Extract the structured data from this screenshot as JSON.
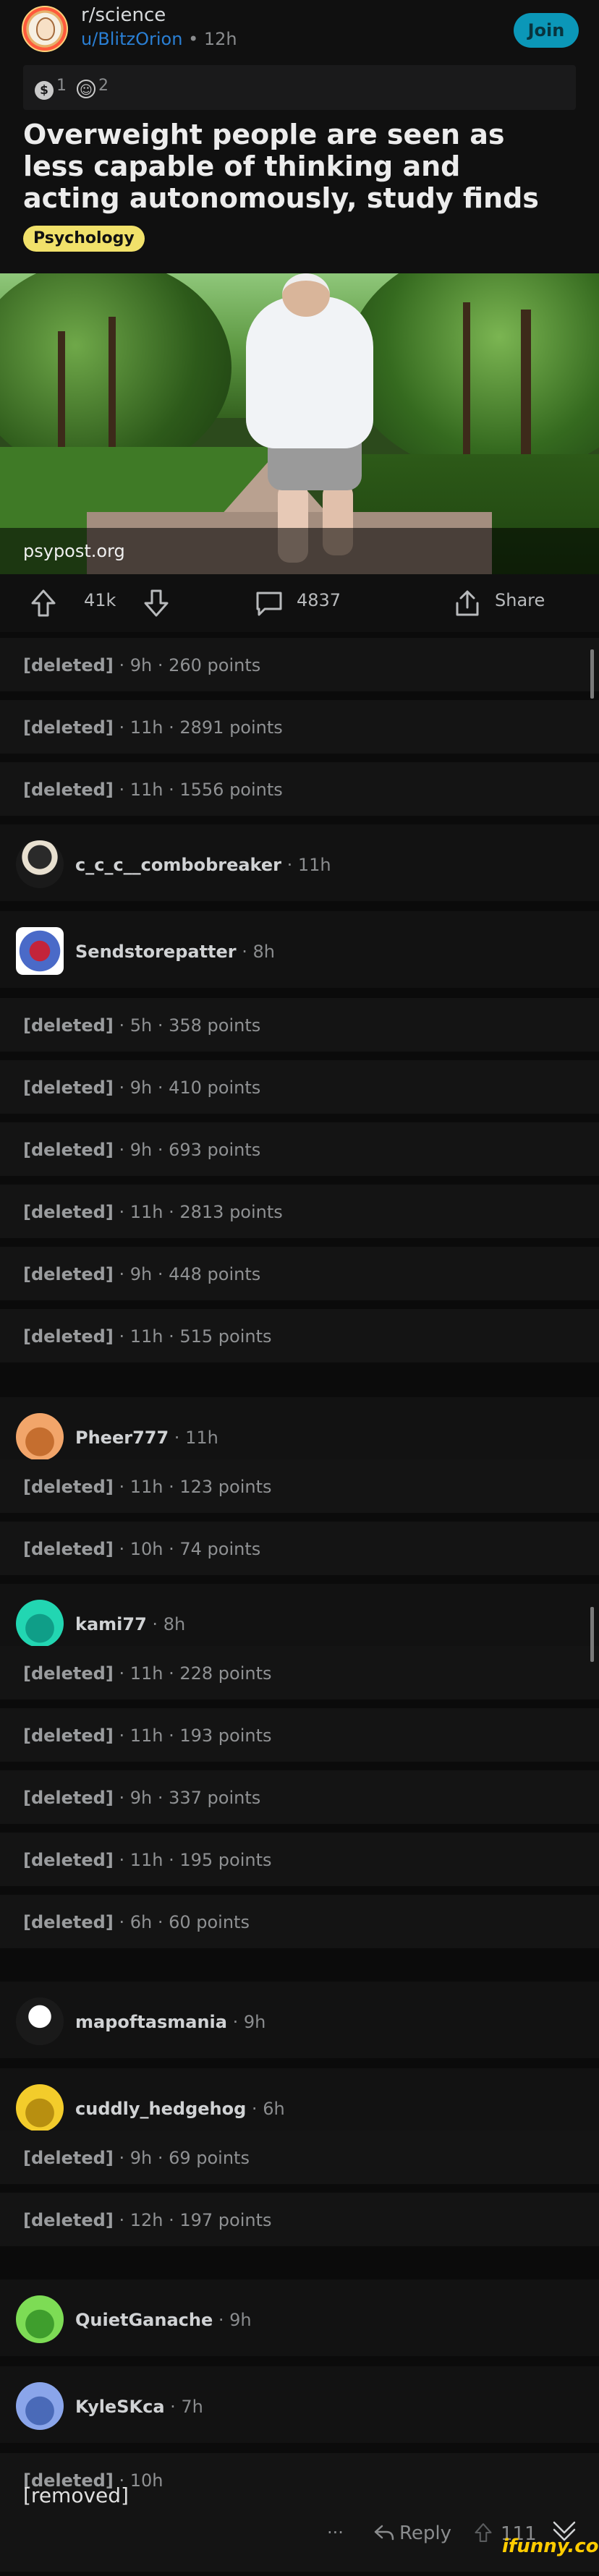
{
  "header": {
    "subreddit": "r/science",
    "username": "u/BlitzOrion",
    "separator": "•",
    "time": "12h",
    "join_label": "Join",
    "awards": [
      {
        "icon": "coin-award-icon",
        "count": "1"
      },
      {
        "icon": "helpful-award-icon",
        "count": "2"
      }
    ],
    "title": "Overweight people are seen as less capable of thinking and acting autonomously, study finds",
    "flair": "Psychology",
    "flair_color": "#f1e16a",
    "join_color": "#0b97b8"
  },
  "image": {
    "caption": "psypost.org"
  },
  "actions": {
    "upvotes": "41k",
    "comments": "4837",
    "share_label": "Share"
  },
  "comments": [
    {
      "type": "deleted",
      "author": "[deleted]",
      "time": "9h",
      "points": "260 points"
    },
    {
      "type": "deleted",
      "author": "[deleted]",
      "time": "11h",
      "points": "2891 points"
    },
    {
      "type": "deleted",
      "author": "[deleted]",
      "time": "11h",
      "points": "1556 points"
    },
    {
      "type": "user",
      "author": "c_c_c__combobreaker",
      "time": "11h"
    },
    {
      "type": "user",
      "author": "Sendstorepatter",
      "time": "8h"
    },
    {
      "type": "deleted",
      "author": "[deleted]",
      "time": "5h",
      "points": "358 points"
    },
    {
      "type": "deleted",
      "author": "[deleted]",
      "time": "9h",
      "points": "410 points"
    },
    {
      "type": "deleted",
      "author": "[deleted]",
      "time": "9h",
      "points": "693 points"
    },
    {
      "type": "deleted",
      "author": "[deleted]",
      "time": "11h",
      "points": "2813 points"
    },
    {
      "type": "deleted",
      "author": "[deleted]",
      "time": "9h",
      "points": "448 points"
    },
    {
      "type": "deleted",
      "author": "[deleted]",
      "time": "11h",
      "points": "515 points"
    },
    {
      "type": "user",
      "author": "Pheer777",
      "time": "11h"
    },
    {
      "type": "deleted",
      "author": "[deleted]",
      "time": "11h",
      "points": "123 points"
    },
    {
      "type": "deleted",
      "author": "[deleted]",
      "time": "10h",
      "points": "74 points"
    },
    {
      "type": "user",
      "author": "kami77",
      "time": "8h"
    },
    {
      "type": "deleted",
      "author": "[deleted]",
      "time": "11h",
      "points": "228 points"
    },
    {
      "type": "deleted",
      "author": "[deleted]",
      "time": "11h",
      "points": "193 points"
    },
    {
      "type": "deleted",
      "author": "[deleted]",
      "time": "9h",
      "points": "337 points"
    },
    {
      "type": "deleted",
      "author": "[deleted]",
      "time": "11h",
      "points": "195 points"
    },
    {
      "type": "deleted",
      "author": "[deleted]",
      "time": "6h",
      "points": "60 points"
    },
    {
      "type": "user",
      "author": "mapoftasmania",
      "time": "9h"
    },
    {
      "type": "user",
      "author": "cuddly_hedgehog",
      "time": "6h"
    },
    {
      "type": "deleted",
      "author": "[deleted]",
      "time": "9h",
      "points": "69 points"
    },
    {
      "type": "deleted",
      "author": "[deleted]",
      "time": "12h",
      "points": "197 points"
    },
    {
      "type": "user",
      "author": "QuietGanache",
      "time": "9h"
    },
    {
      "type": "user",
      "author": "KyleSKca",
      "time": "7h"
    },
    {
      "type": "deleted",
      "author": "[deleted]",
      "time": "10h",
      "points": ""
    }
  ],
  "last_comment": {
    "body": "[removed]",
    "more": "···",
    "reply_label": "Reply",
    "votes": "111"
  },
  "watermark": "ifunny.co"
}
